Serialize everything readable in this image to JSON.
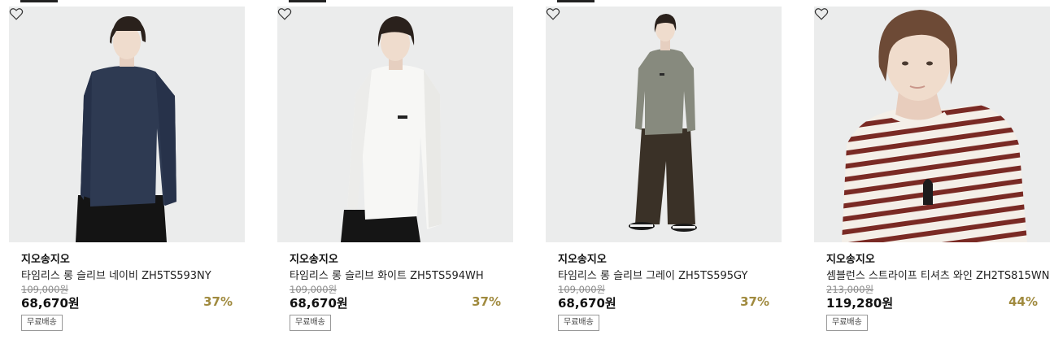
{
  "products": [
    {
      "brand": "지오송지오",
      "name": "타임리스 롱 슬리브 네이비 ZH5TS593NY",
      "original_price": "109,000원",
      "sale_price": "68,670원",
      "discount": "37%",
      "badge": "무료배송",
      "shirt_color": "#2e3a52"
    },
    {
      "brand": "지오송지오",
      "name": "타임리스 롱 슬리브 화이트 ZH5TS594WH",
      "original_price": "109,000원",
      "sale_price": "68,670원",
      "discount": "37%",
      "badge": "무료배송",
      "shirt_color": "#f4f4f2"
    },
    {
      "brand": "지오송지오",
      "name": "타임리스 롱 슬리브 그레이 ZH5TS595GY",
      "original_price": "109,000원",
      "sale_price": "68,670원",
      "discount": "37%",
      "badge": "무료배송",
      "shirt_color": "#878a7e"
    },
    {
      "brand": "지오송지오",
      "name": "셈블런스 스트라이프 티셔츠 와인 ZH2TS815WN",
      "original_price": "213,000원",
      "sale_price": "119,280원",
      "discount": "44%",
      "badge": "무료배송",
      "shirt_color": "#7a2a24"
    }
  ],
  "colors": {
    "discount": "#a08a3e",
    "photo_bg": "#e9eaea"
  },
  "icons": {
    "wishlist": "heart-outline-icon"
  }
}
